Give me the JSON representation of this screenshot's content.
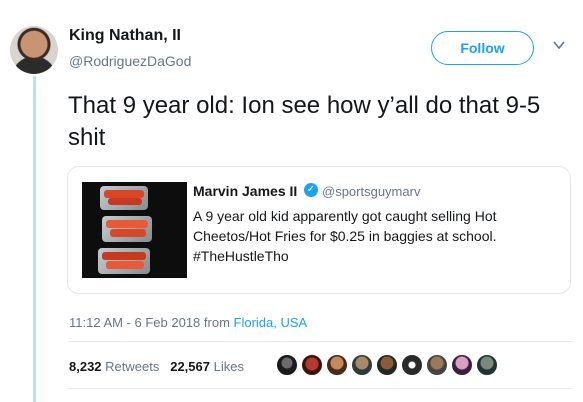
{
  "author": {
    "name": "King Nathan, II",
    "handle": "@RodriguezDaGod"
  },
  "follow_label": "Follow",
  "tweet": {
    "text": "That 9 year old: Ion see how y’all do that 9-5 shit"
  },
  "quoted": {
    "name": "Marvin James II",
    "verified_glyph": "✓",
    "handle": "@sportsguymarv",
    "text": "A 9 year old kid apparently got caught selling Hot Cheetos/Hot Fries for $0.25 in baggies at school. #TheHustleTho"
  },
  "timestamp": "11:12 AM - 6 Feb 2018 from",
  "location": "Florida, USA",
  "stats": {
    "retweets_count": "8,232",
    "retweets_label": "Retweets",
    "likes_count": "22,567",
    "likes_label": "Likes"
  },
  "colors": {
    "accent": "#1da1f2",
    "thread_line": "#b8e0f6"
  }
}
